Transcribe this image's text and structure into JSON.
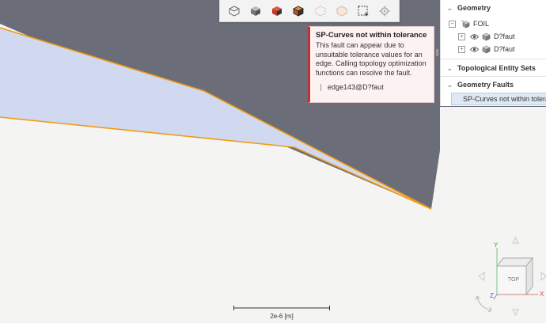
{
  "toolbar": {
    "buttons": [
      {
        "icon": "view-cube-outline-icon"
      },
      {
        "icon": "view-cube-shaded-icon"
      },
      {
        "icon": "view-cube-color-icon"
      },
      {
        "icon": "view-cube-edges-icon"
      },
      {
        "icon": "view-points-icon"
      },
      {
        "icon": "view-transparent-icon"
      },
      {
        "icon": "box-select-icon"
      },
      {
        "icon": "settings-gear-icon"
      }
    ]
  },
  "fault_tooltip": {
    "title": "SP-Curves not within tolerance",
    "description": "This fault can appear due to unsuitable tolerance values for an edge. Calling topology optimization functions can resolve the fault.",
    "entity": "edge143@D?faut"
  },
  "tree": {
    "geometry_label": "Geometry",
    "foil_label": "FOIL",
    "children": [
      "D?faut",
      "D?faut"
    ],
    "topological_label": "Topological Entity Sets",
    "faults_label": "Geometry Faults",
    "fault_item": "SP-Curves not within tolerance"
  },
  "scale": {
    "label": "2e-6 [m]"
  },
  "view_cube": {
    "face_label": "TOP",
    "x_axis": "X",
    "y_axis": "Y",
    "z_axis": "Z"
  },
  "colors": {
    "viewport_dark": "#6b6d79",
    "viewport_light": "#f4f4f2",
    "face_fill": "#d1d9f1",
    "edge": "#f29a12",
    "fault_red": "#c0303a"
  }
}
